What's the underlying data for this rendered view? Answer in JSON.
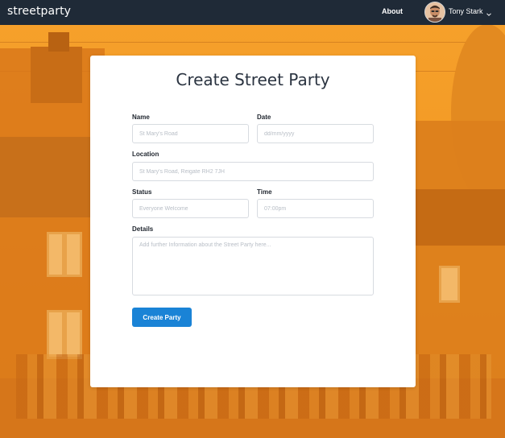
{
  "navbar": {
    "brand": "streetparty",
    "about_label": "About",
    "user_name": "Tony Stark"
  },
  "form": {
    "title": "Create Street Party",
    "name_label": "Name",
    "name_placeholder": "St Mary's Road",
    "date_label": "Date",
    "date_placeholder": "dd/mm/yyyy",
    "location_label": "Location",
    "location_placeholder": "St Mary's Road, Reigate RH2 7JH",
    "status_label": "Status",
    "status_placeholder": "Everyone Welcome",
    "time_label": "Time",
    "time_placeholder": "07:00pm",
    "details_label": "Details",
    "details_placeholder": "Add further Information about the Street Party here...",
    "submit_label": "Create Party"
  },
  "colors": {
    "navbar_bg": "#1f2a37",
    "background_overlay": "#f0941e",
    "button": "#1a83d6",
    "title_text": "#2b3441"
  },
  "icons": {
    "user_menu": "chevron-down-icon"
  }
}
